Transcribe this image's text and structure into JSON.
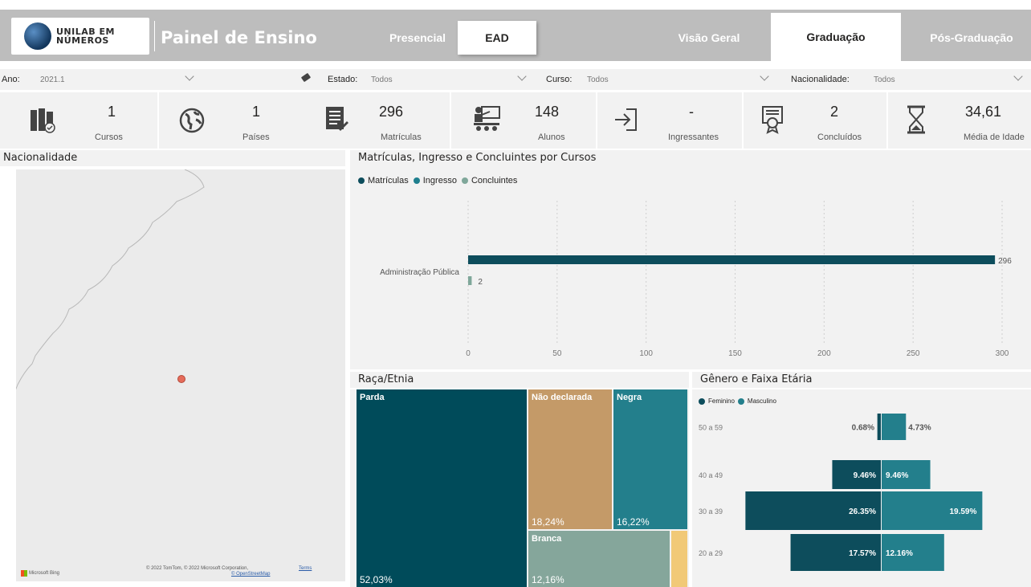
{
  "header": {
    "logo_line1": "UNILAB EM",
    "logo_line2": "NÚMEROS",
    "app_title": "Painel de Ensino",
    "mode_tabs": [
      {
        "label": "Presencial",
        "active": false
      },
      {
        "label": "EAD",
        "active": true
      }
    ],
    "level_tabs": [
      {
        "label": "Visão Geral",
        "active": false
      },
      {
        "label": "Graduação",
        "active": true
      },
      {
        "label": "Pós-Graduação",
        "active": false
      }
    ]
  },
  "filters": {
    "ano": {
      "label": "Ano:",
      "value": "2021.1"
    },
    "estado": {
      "label": "Estado:",
      "value": "Todos"
    },
    "curso": {
      "label": "Curso:",
      "value": "Todos"
    },
    "nacionalidade": {
      "label": "Nacionalidade:",
      "value": "Todos"
    }
  },
  "kpis": [
    {
      "value": "1",
      "label": "Cursos",
      "icon": "books-icon"
    },
    {
      "value": "1",
      "label": "Países",
      "icon": "globe-icon"
    },
    {
      "value": "296",
      "label": "Matrículas",
      "icon": "document-list-icon"
    },
    {
      "value": "148",
      "label": "Alunos",
      "icon": "classroom-icon"
    },
    {
      "value": "-",
      "label": "Ingressantes",
      "icon": "enter-arrow-icon"
    },
    {
      "value": "2",
      "label": "Concluídos",
      "icon": "certificate-icon"
    },
    {
      "value": "34,61",
      "label": "Média de Idade",
      "icon": "hourglass-icon"
    }
  ],
  "map_panel": {
    "title": "Nacionalidade",
    "bing_label": "Microsoft Bing",
    "credit_line1": "© 2022 TomTom, © 2022 Microsoft Corporation,",
    "credit_terms": "Terms",
    "credit_line2": "© OpenStreetMap"
  },
  "chart_data": [
    {
      "type": "bar",
      "title": "Matrículas, Ingresso e Concluintes por Cursos",
      "orientation": "horizontal",
      "categories": [
        "Administração Pública"
      ],
      "series": [
        {
          "name": "Matrículas",
          "values": [
            296
          ],
          "color": "#0d4d5c"
        },
        {
          "name": "Ingresso",
          "values": [
            0
          ],
          "color": "#1f7f8e"
        },
        {
          "name": "Concluintes",
          "values": [
            2
          ],
          "color": "#7fa79a"
        }
      ],
      "xlim": [
        0,
        300
      ],
      "xticks": [
        "0",
        "50",
        "100",
        "150",
        "200",
        "250",
        "300"
      ],
      "data_labels": [
        "296",
        "2"
      ],
      "legend_placement": "top-left"
    },
    {
      "type": "treemap",
      "title": "Raça/Etnia",
      "items": [
        {
          "name": "Parda",
          "value": 52.03,
          "label": "52,03%",
          "color": "#004b5a"
        },
        {
          "name": "Não declarada",
          "value": 18.24,
          "label": "18,24%",
          "color": "#c49a68"
        },
        {
          "name": "Negra",
          "value": 16.22,
          "label": "16,22%",
          "color": "#237f8c"
        },
        {
          "name": "Branca",
          "value": 12.16,
          "label": "12,16%",
          "color": "#85a69b"
        },
        {
          "name": "",
          "value": 1.35,
          "label": "",
          "color": "#f1c977"
        }
      ]
    },
    {
      "type": "bar",
      "title": "Gênero e Faixa Etária",
      "orientation": "horizontal-diverging",
      "categories": [
        "50 a 59",
        "40 a 49",
        "30 a 39",
        "20 a 29"
      ],
      "series": [
        {
          "name": "Feminino",
          "values": [
            0.68,
            9.46,
            26.35,
            17.57
          ],
          "labels": [
            "0.68%",
            "9.46%",
            "26.35%",
            "17.57%"
          ],
          "color": "#0d4d5c"
        },
        {
          "name": "Masculino",
          "values": [
            4.73,
            9.46,
            19.59,
            12.16
          ],
          "labels": [
            "4.73%",
            "9.46%",
            "19.59%",
            "12.16%"
          ],
          "color": "#237f8c"
        }
      ],
      "legend_placement": "top-left"
    }
  ]
}
